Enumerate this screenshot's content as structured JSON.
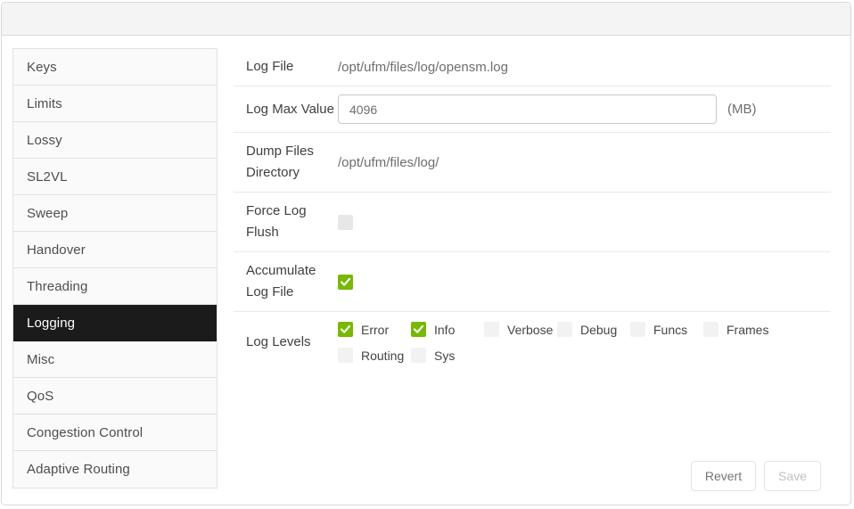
{
  "sidebar": {
    "items": [
      {
        "label": "Keys",
        "selected": false
      },
      {
        "label": "Limits",
        "selected": false
      },
      {
        "label": "Lossy",
        "selected": false
      },
      {
        "label": "SL2VL",
        "selected": false
      },
      {
        "label": "Sweep",
        "selected": false
      },
      {
        "label": "Handover",
        "selected": false
      },
      {
        "label": "Threading",
        "selected": false
      },
      {
        "label": "Logging",
        "selected": true
      },
      {
        "label": "Misc",
        "selected": false
      },
      {
        "label": "QoS",
        "selected": false
      },
      {
        "label": "Congestion Control",
        "selected": false
      },
      {
        "label": "Adaptive Routing",
        "selected": false
      }
    ]
  },
  "form": {
    "log_file": {
      "label": "Log File",
      "value": "/opt/ufm/files/log/opensm.log"
    },
    "log_max_value": {
      "label": "Log Max Value",
      "value": "4096",
      "unit": "(MB)"
    },
    "dump_files_directory": {
      "label": "Dump Files Directory",
      "value": "/opt/ufm/files/log/"
    },
    "force_log_flush": {
      "label": "Force Log Flush",
      "checked": false
    },
    "accumulate_log_file": {
      "label": "Accumulate Log File",
      "checked": true
    },
    "log_levels": {
      "label": "Log Levels",
      "options": [
        {
          "label": "Error",
          "checked": true
        },
        {
          "label": "Info",
          "checked": true
        },
        {
          "label": "Verbose",
          "checked": false
        },
        {
          "label": "Debug",
          "checked": false
        },
        {
          "label": "Funcs",
          "checked": false
        },
        {
          "label": "Frames",
          "checked": false
        },
        {
          "label": "Routing",
          "checked": false
        },
        {
          "label": "Sys",
          "checked": false
        }
      ]
    }
  },
  "buttons": {
    "revert": "Revert",
    "save": "Save"
  },
  "colors": {
    "accent_green": "#76b900",
    "selected_item_bg": "#1b1b1b"
  }
}
